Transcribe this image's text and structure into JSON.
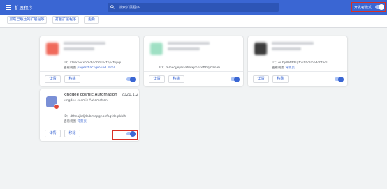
{
  "header": {
    "title": "扩展程序",
    "search_placeholder": "搜索扩展程序",
    "dev_mode_label": "开发者模式"
  },
  "toolbar": {
    "load_unpacked": "加载已解压的扩展程序",
    "pack": "打包扩展程序",
    "update": "更新"
  },
  "cards": [
    {
      "id_label": "ID：",
      "id": "k9iiksecxbmdjodhmlnctbpcfupqu",
      "inspect_label": "查看视图",
      "inspect_link": "pages/background.html",
      "details": "详情",
      "remove": "移除",
      "icon_color": "#f0695a",
      "enabled": true
    },
    {
      "id_label": "ID：",
      "id": "mloxqjjepbaahelkjmbkeffhqmaoab",
      "details": "详情",
      "remove": "移除",
      "icon_color": "#9fe0c4",
      "enabled": true
    },
    {
      "id_label": "ID：",
      "id": "ouhjdlhfddsgfpkhbdlmoddbfedl",
      "inspect_label": "查看视图",
      "inspect_link": "背景页",
      "details": "详情",
      "remove": "移除",
      "icon_color": "#3c3c3c",
      "enabled": true
    },
    {
      "name": "kingdee cosmic Automation",
      "version": "2021.1.2",
      "description": "kingdee cosmic Automation",
      "id_label": "ID：",
      "id": "dfhnajkdjdaibmapgnbnfagfdelpkblh",
      "inspect_label": "查看视图",
      "inspect_link": "背景页",
      "details": "详情",
      "remove": "移除",
      "icon_color": "#7a8fd6",
      "enabled": true
    }
  ]
}
